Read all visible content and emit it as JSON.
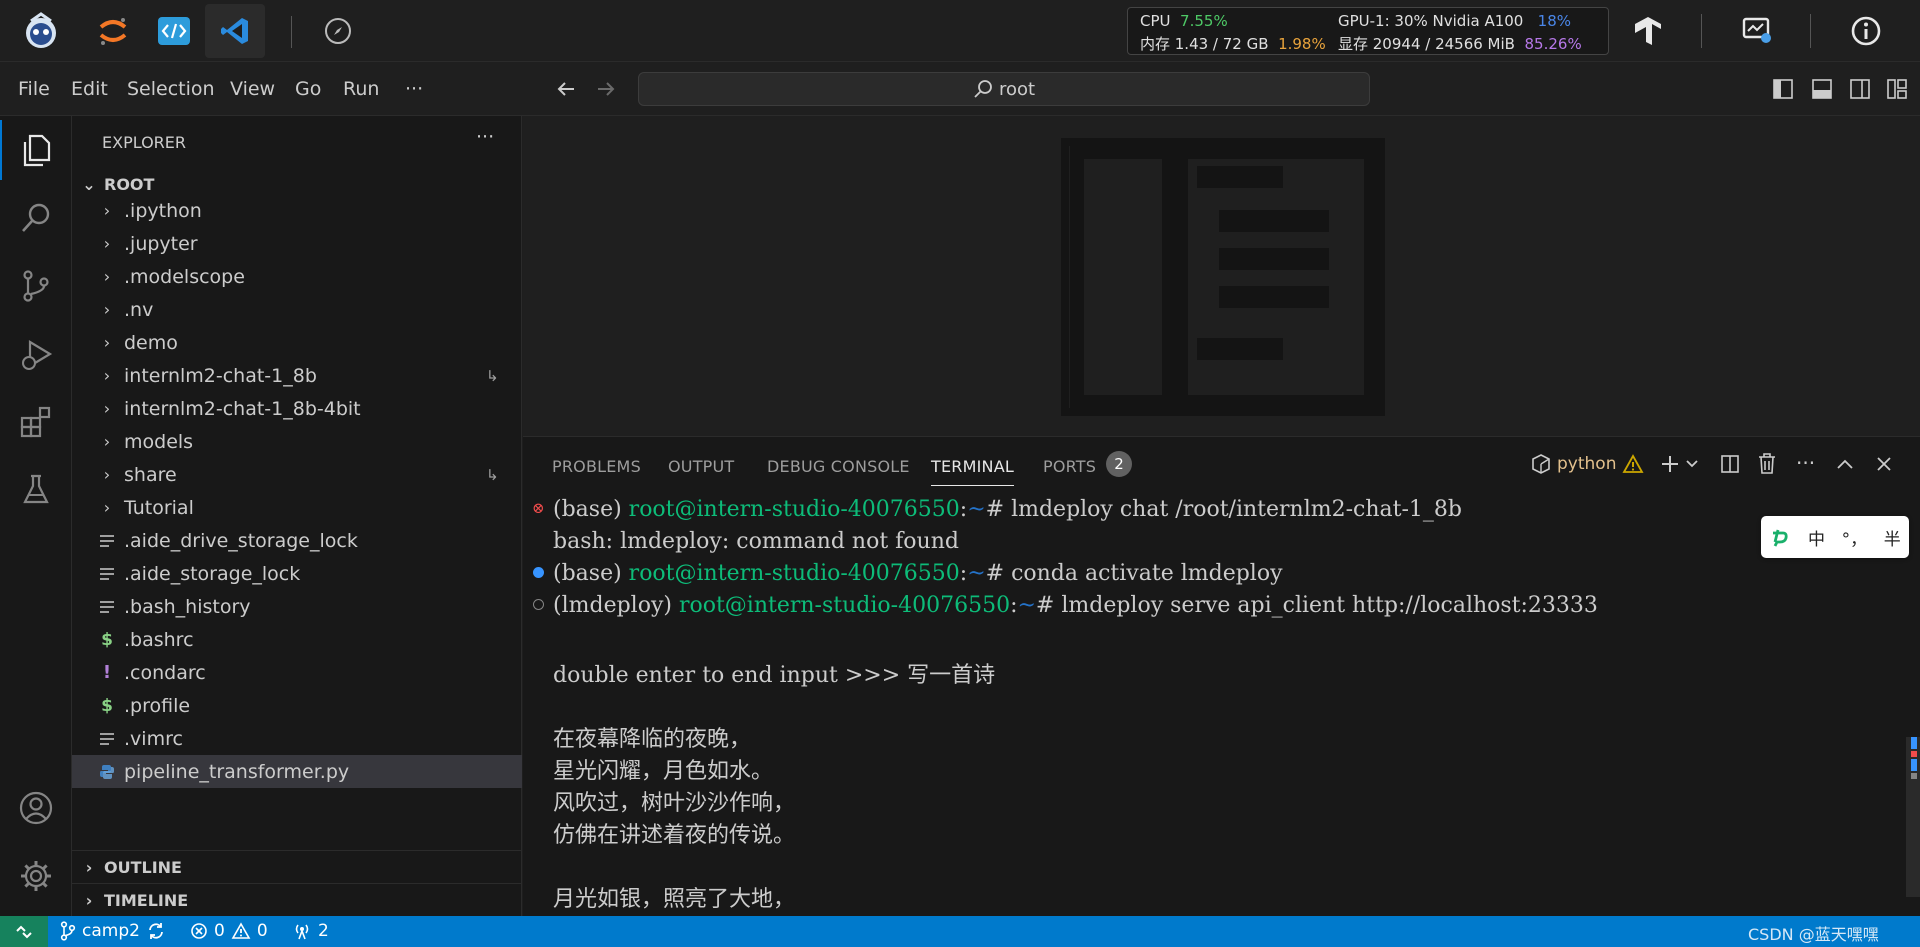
{
  "host": {
    "apps": [
      "intern-logo-icon",
      "jupyter-icon",
      "code-icon",
      "vscode-icon",
      "compass-icon"
    ],
    "monitor": {
      "cpu_label": "CPU",
      "cpu_value": "7.55%",
      "mem_label": "内存 1.43 / 72 GB",
      "mem_value": "1.98%",
      "gpu_label": "GPU-1: 30% Nvidia A100",
      "gpu_value": "18%",
      "vram_label": "显存 20944 / 24566 MiB",
      "vram_value": "85.26%"
    }
  },
  "menubar": {
    "items": [
      "File",
      "Edit",
      "Selection",
      "View",
      "Go",
      "Run",
      "···"
    ],
    "search": "root"
  },
  "sidebar": {
    "title": "EXPLORER",
    "more": "···",
    "root": "ROOT",
    "items": [
      {
        "label": ".ipython",
        "kind": "folder"
      },
      {
        "label": ".jupyter",
        "kind": "folder"
      },
      {
        "label": ".modelscope",
        "kind": "folder"
      },
      {
        "label": ".nv",
        "kind": "folder"
      },
      {
        "label": "demo",
        "kind": "folder"
      },
      {
        "label": "internlm2-chat-1_8b",
        "kind": "folder",
        "link": true
      },
      {
        "label": "internlm2-chat-1_8b-4bit",
        "kind": "folder"
      },
      {
        "label": "models",
        "kind": "folder"
      },
      {
        "label": "share",
        "kind": "folder",
        "link": true
      },
      {
        "label": "Tutorial",
        "kind": "folder"
      },
      {
        "label": ".aide_drive_storage_lock",
        "kind": "file"
      },
      {
        "label": ".aide_storage_lock",
        "kind": "file"
      },
      {
        "label": ".bash_history",
        "kind": "file"
      },
      {
        "label": ".bashrc",
        "kind": "shell"
      },
      {
        "label": ".condarc",
        "kind": "bang"
      },
      {
        "label": ".profile",
        "kind": "shell"
      },
      {
        "label": ".vimrc",
        "kind": "file"
      },
      {
        "label": "pipeline_transformer.py",
        "kind": "python",
        "selected": true
      }
    ],
    "outline": "OUTLINE",
    "timeline": "TIMELINE"
  },
  "panel": {
    "tabs": [
      {
        "label": "PROBLEMS"
      },
      {
        "label": "OUTPUT"
      },
      {
        "label": "DEBUG CONSOLE"
      },
      {
        "label": "TERMINAL",
        "active": true
      },
      {
        "label": "PORTS",
        "badge": "2"
      }
    ],
    "shell": "python"
  },
  "terminal": {
    "l1_env": "(base) ",
    "l1_host": "root@intern-studio-40076550",
    "l1_path": "~",
    "l1_cmd": "# lmdeploy chat /root/internlm2-chat-1_8b",
    "l2": "bash: lmdeploy: command not found",
    "l3_env": "(base) ",
    "l3_host": "root@intern-studio-40076550",
    "l3_path": "~",
    "l3_cmd": "# conda activate lmdeploy",
    "l4_env": "(lmdeploy) ",
    "l4_host": "root@intern-studio-40076550",
    "l4_path": "~",
    "l4_cmd": "# lmdeploy serve api_client http://localhost:23333",
    "l5": "double enter to end input >>> 写一首诗",
    "l6": "在夜幕降临的夜晚，",
    "l7": "星光闪耀，月色如水。",
    "l8": "风吹过，树叶沙沙作响，",
    "l9": "仿佛在讲述着夜的传说。",
    "l10": "月光如银，照亮了大地，"
  },
  "ime": {
    "lang": "中",
    "punct": "°，",
    "width": "半"
  },
  "statusbar": {
    "branch": "camp2",
    "errors": "0",
    "warnings": "0",
    "ports": "2",
    "watermark": "CSDN @蓝天嘿嘿"
  }
}
